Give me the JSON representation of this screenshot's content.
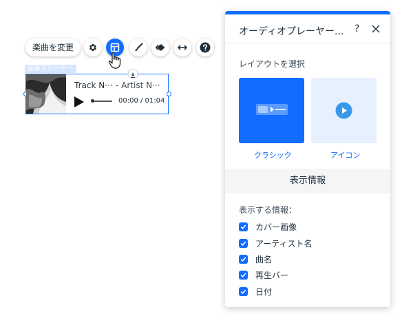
{
  "toolbar": {
    "change_music_label": "楽曲を変更",
    "icons": [
      "gear-icon",
      "layout-icon",
      "brush-icon",
      "animation-icon",
      "stretch-icon",
      "help-icon"
    ]
  },
  "widget": {
    "tag_label": "音楽プレーヤー",
    "track_name": "Track N···",
    "artist_name": "- Artist N···",
    "time": "00:00 / 01:04"
  },
  "panel": {
    "title": "オーディオプレーヤー...",
    "help": "?",
    "layout_section_label": "レイアウトを選択",
    "layouts": [
      {
        "label": "クラシック",
        "selected": true
      },
      {
        "label": "アイコン",
        "selected": false
      }
    ],
    "info_header": "表示情報",
    "info_section_label": "表示する情報：",
    "checkboxes": [
      {
        "label": "カバー画像",
        "checked": true
      },
      {
        "label": "アーティスト名",
        "checked": true
      },
      {
        "label": "曲名",
        "checked": true
      },
      {
        "label": "再生バー",
        "checked": true
      },
      {
        "label": "日付",
        "checked": true
      }
    ]
  },
  "colors": {
    "accent": "#116dff",
    "accent_light": "#e7f0ff",
    "text": "#20303c"
  }
}
